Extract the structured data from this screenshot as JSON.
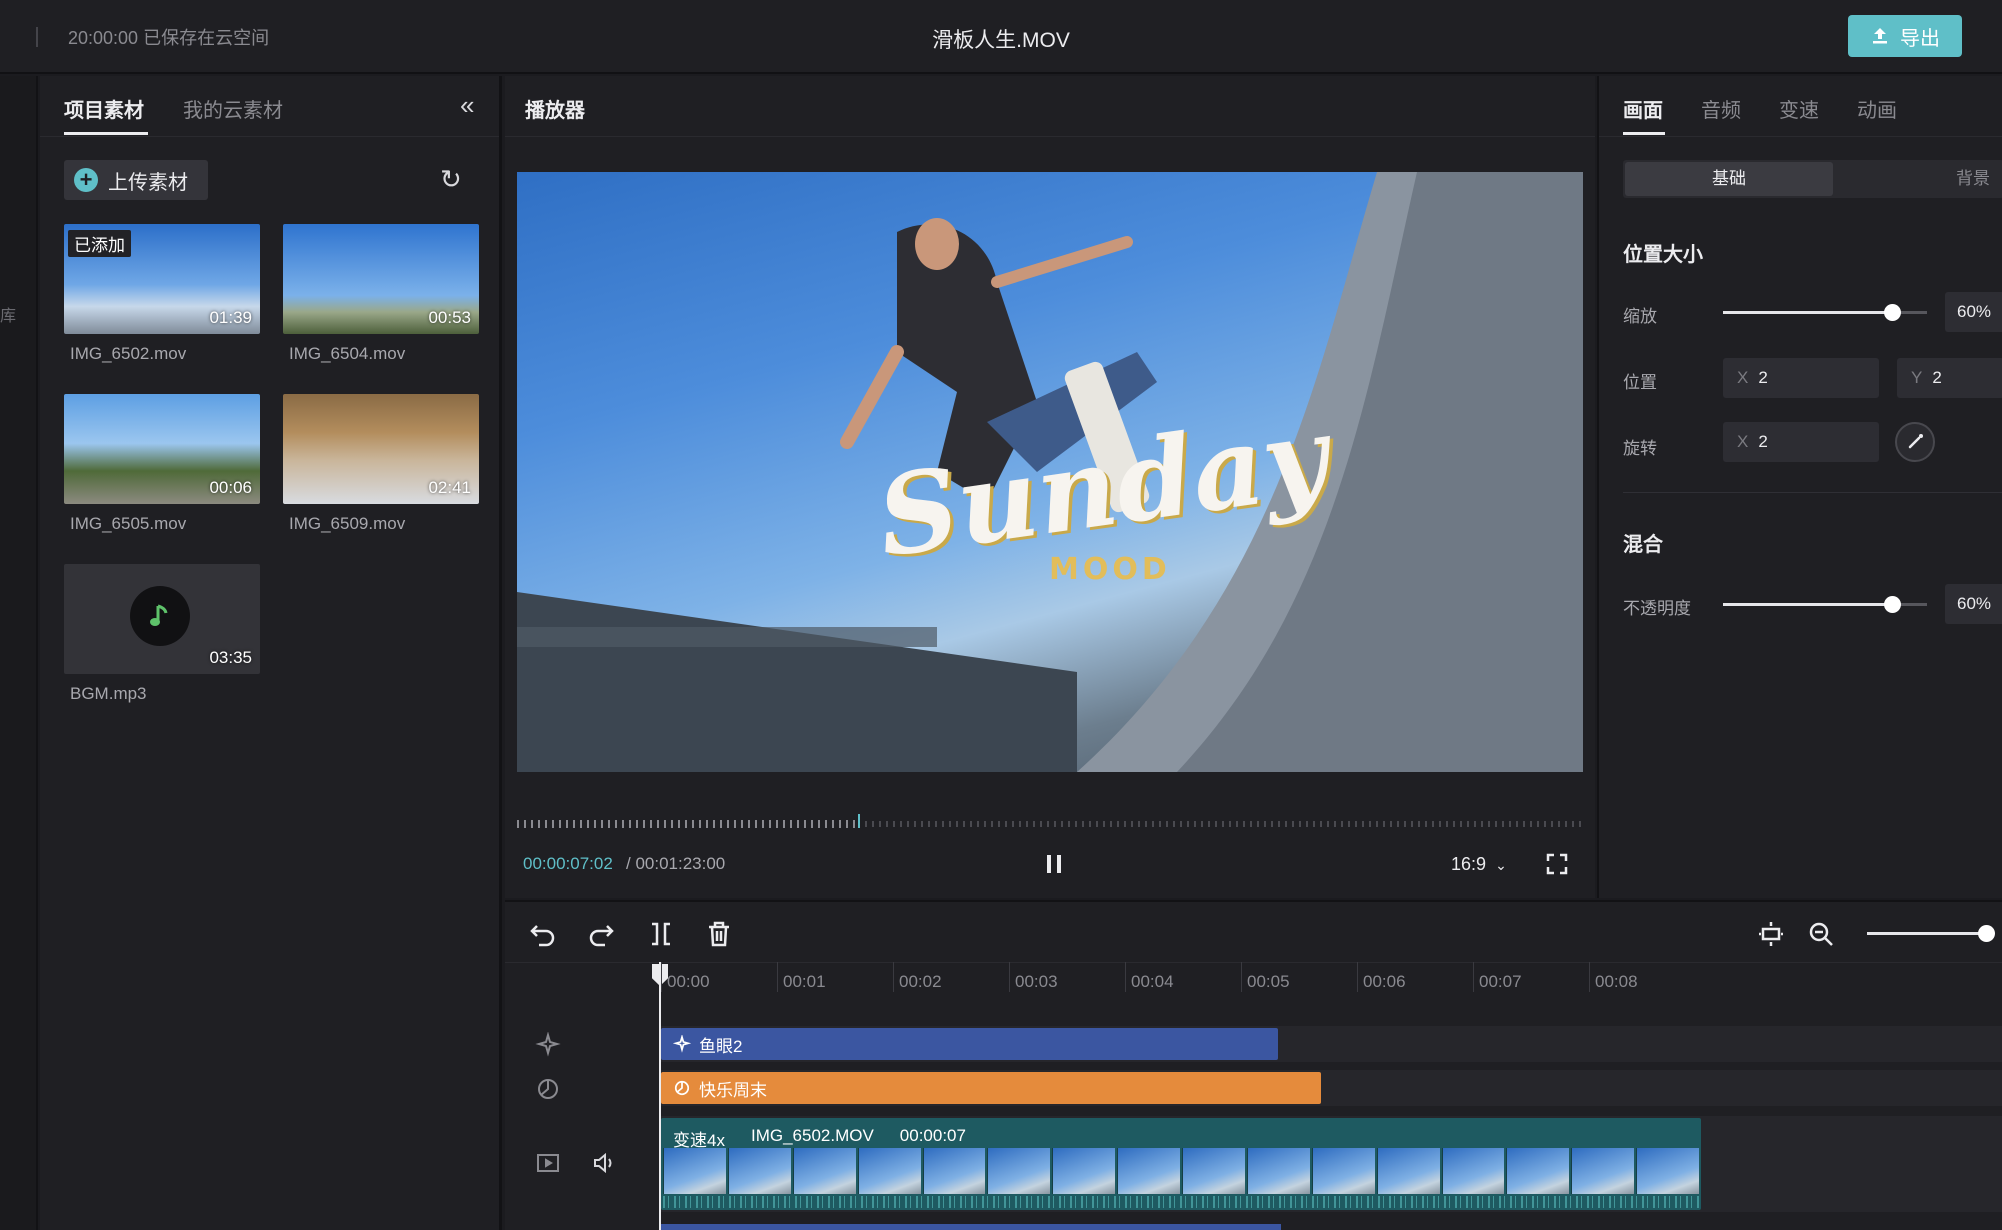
{
  "header": {
    "save_status": "20:00:00 已保存在云空间",
    "title": "滑板人生.MOV",
    "export_label": "导出"
  },
  "left_strip": {
    "glyph": "库"
  },
  "media": {
    "tabs": [
      "项目素材",
      "我的云素材"
    ],
    "upload_label": "上传素材",
    "clips": [
      {
        "name": "IMG_6502.mov",
        "duration": "01:39",
        "badge": "已添加"
      },
      {
        "name": "IMG_6504.mov",
        "duration": "00:53"
      },
      {
        "name": "IMG_6505.mov",
        "duration": "00:06"
      },
      {
        "name": "IMG_6509.mov",
        "duration": "02:41"
      },
      {
        "name": "BGM.mp3",
        "duration": "03:35"
      }
    ]
  },
  "player": {
    "title": "播放器",
    "overlay_title": "Sunday",
    "overlay_subtitle": "MOOD",
    "current_time": "00:00:07:02",
    "total_time": "/ 00:01:23:00",
    "progress": 0.32,
    "aspect_ratio": "16:9"
  },
  "properties": {
    "tabs": [
      "画面",
      "音频",
      "变速",
      "动画"
    ],
    "segments": [
      "基础",
      "背景"
    ],
    "position_size_title": "位置大小",
    "scale_label": "缩放",
    "scale_value": "60%",
    "scale_level": 0.83,
    "position_label": "位置",
    "position_x_axis": "X",
    "position_x": "2",
    "position_y_axis": "Y",
    "position_y": "2",
    "rotate_label": "旋转",
    "rotate_x_axis": "X",
    "rotate_x": "2",
    "blend_title": "混合",
    "opacity_label": "不透明度",
    "opacity_value": "60%",
    "opacity_level": 0.83
  },
  "timeline": {
    "ticks": [
      "00:00",
      "00:01",
      "00:02",
      "00:03",
      "00:04",
      "00:05",
      "00:06",
      "00:07",
      "00:08"
    ],
    "effect_clip": "鱼眼2",
    "filter_clip": "快乐周末",
    "video_clip": {
      "speed": "变速4x",
      "name": "IMG_6502.MOV",
      "duration": "00:00:07"
    }
  },
  "colors": {
    "accent": "#5fbfc8",
    "effect_track": "#3b56a1",
    "filter_track": "#e58b3c",
    "video_track": "#1e5a61"
  }
}
